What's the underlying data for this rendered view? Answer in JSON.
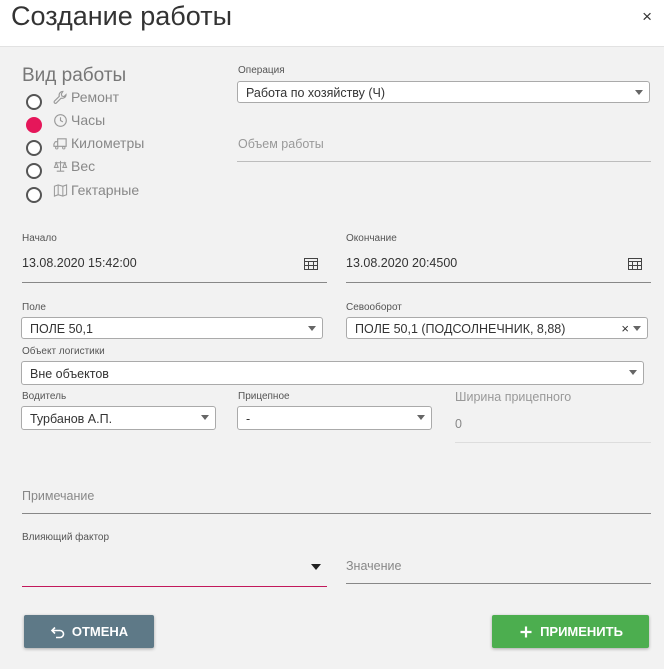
{
  "header": {
    "title": "Создание работы",
    "close_glyph": "×"
  },
  "work_type": {
    "title": "Вид работы",
    "options": [
      {
        "label": "Ремонт",
        "icon": "wrench-icon",
        "checked": false
      },
      {
        "label": "Часы",
        "icon": "clock-icon",
        "checked": true
      },
      {
        "label": "Километры",
        "icon": "truck-icon",
        "checked": false
      },
      {
        "label": "Вес",
        "icon": "scale-icon",
        "checked": false
      },
      {
        "label": "Гектарные",
        "icon": "map-icon",
        "checked": false
      }
    ]
  },
  "operation": {
    "label": "Операция",
    "value": "Работа по хозяйству (Ч)"
  },
  "volume": {
    "placeholder": "Объем работы"
  },
  "start": {
    "label": "Начало",
    "value": "13.08.2020 15:42:00"
  },
  "end": {
    "label": "Окончание",
    "value": "13.08.2020 20:4500"
  },
  "field": {
    "label": "Поле",
    "value": "ПОЛЕ 50,1"
  },
  "rotation": {
    "label": "Севооборот",
    "value": "ПОЛЕ 50,1 (ПОДСОЛНЕЧНИК, 8,88)",
    "clear_glyph": "×"
  },
  "logistics": {
    "label": "Объект логистики",
    "value": "Вне объектов"
  },
  "driver": {
    "label": "Водитель",
    "value": "Турбанов А.П."
  },
  "trailer": {
    "label": "Прицепное",
    "value": "-"
  },
  "trailer_width": {
    "label": "Ширина прицепного",
    "value": "0"
  },
  "note": {
    "placeholder": "Примечание"
  },
  "factor": {
    "label": "Влияющий фактор",
    "value": ""
  },
  "factor_value": {
    "placeholder": "Значение"
  },
  "buttons": {
    "cancel": "ОТМЕНА",
    "apply": "ПРИМЕНИТЬ"
  },
  "colors": {
    "accent": "#e5175a",
    "cancel_bg": "#5e7987",
    "apply_bg": "#4cae4f"
  }
}
